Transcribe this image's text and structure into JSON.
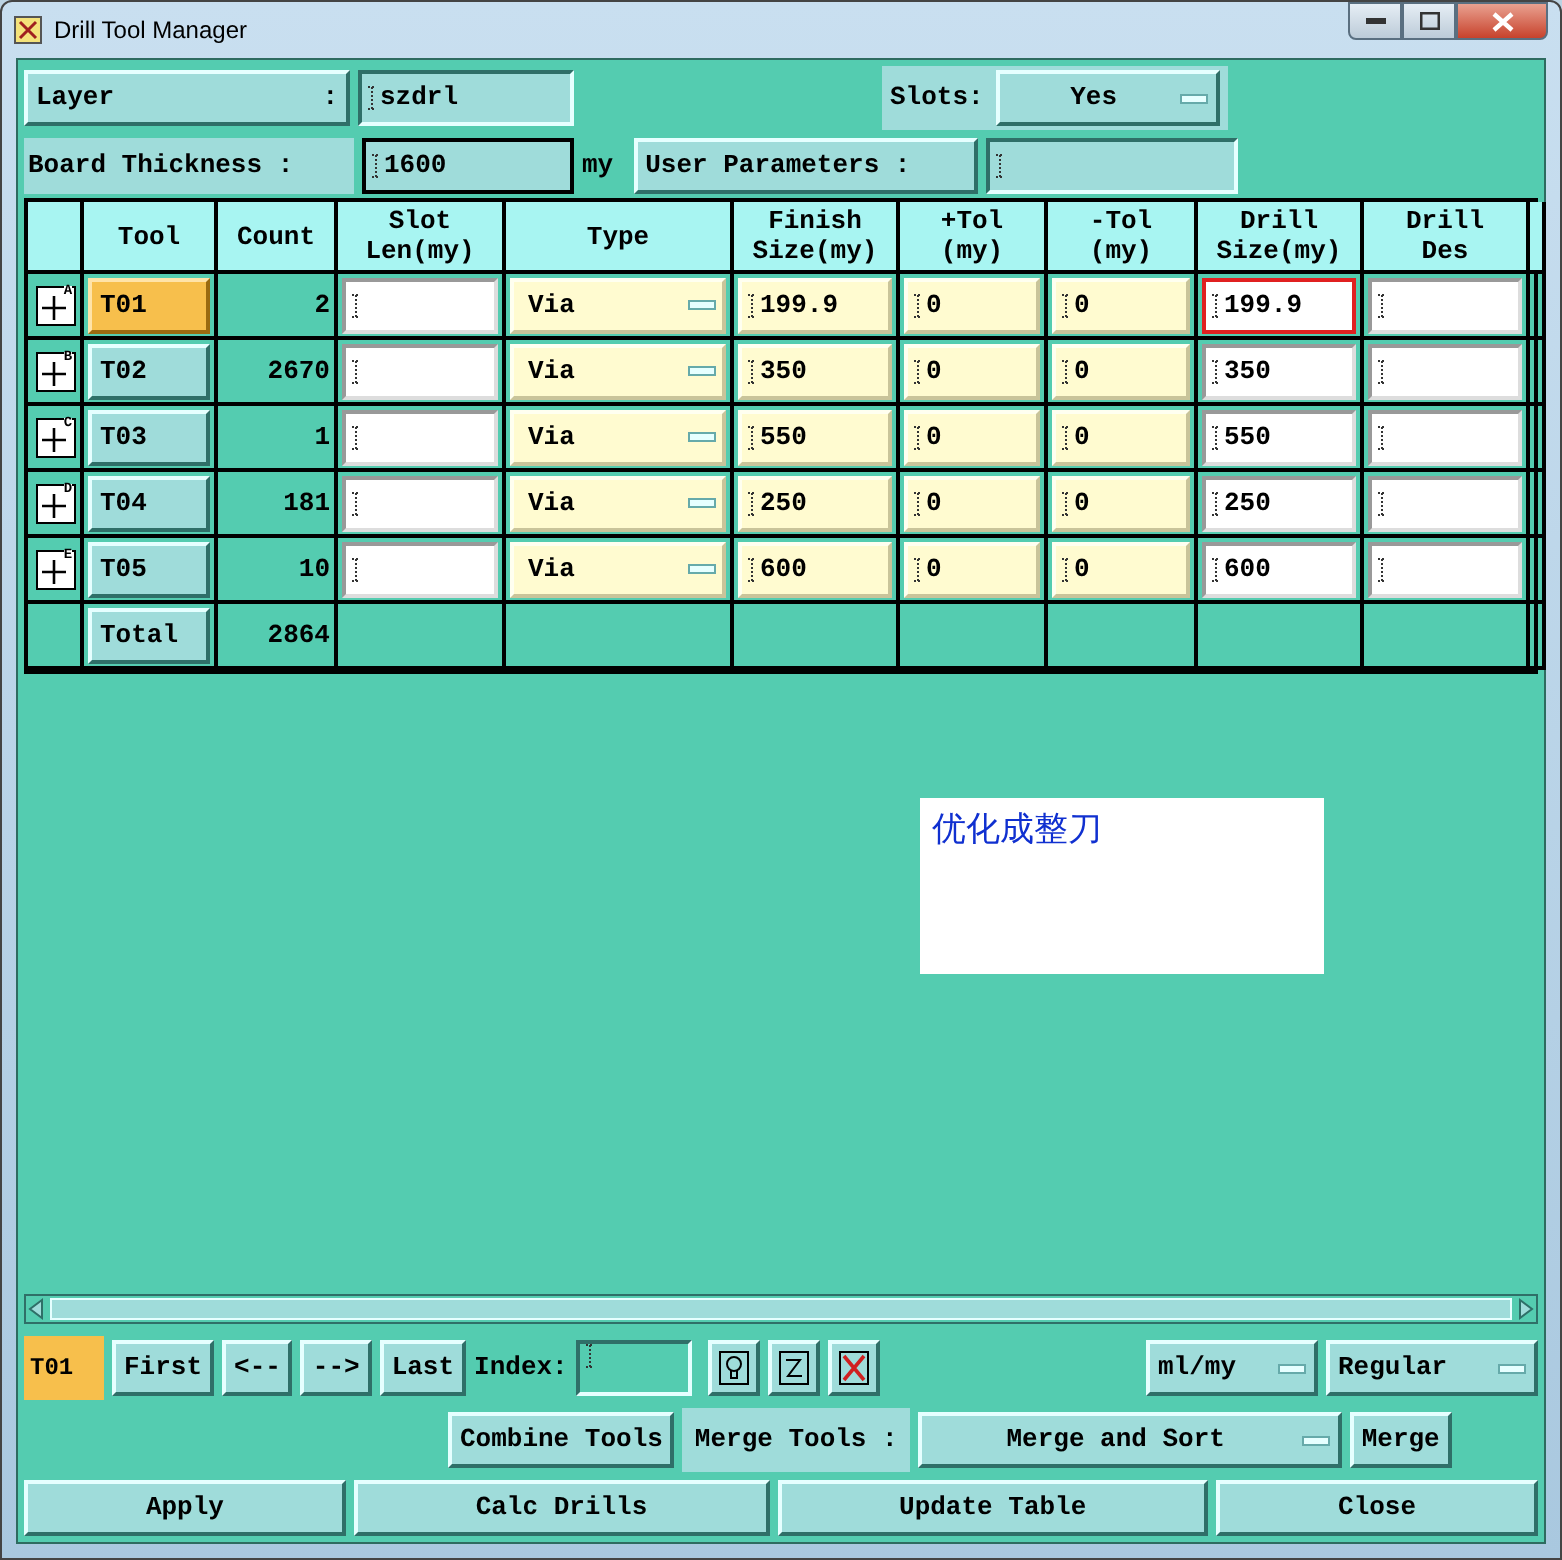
{
  "window": {
    "title": "Drill Tool Manager"
  },
  "layer": {
    "label": "Layer",
    "colon": ":",
    "value": "szdrl"
  },
  "slots": {
    "label": "Slots:",
    "value": "Yes"
  },
  "board_thickness": {
    "label": "Board Thickness :",
    "value": "1600",
    "unit": "my"
  },
  "user_parameters": {
    "label": "User Parameters :"
  },
  "table": {
    "columns": [
      "Tool",
      "Count",
      "Slot\nLen(my)",
      "Type",
      "Finish\nSize(my)",
      "+Tol\n(my)",
      "-Tol\n(my)",
      "Drill\nSize(my)",
      "Drill\nDes"
    ],
    "rows": [
      {
        "marker": "A",
        "tool": "T01",
        "selected": true,
        "count": "2",
        "type": "Via",
        "finish_size": "199.9",
        "plus_tol": "0",
        "minus_tol": "0",
        "drill_size": "199.9",
        "highlighted": true
      },
      {
        "marker": "B",
        "tool": "T02",
        "selected": false,
        "count": "2670",
        "type": "Via",
        "finish_size": "350",
        "plus_tol": "0",
        "minus_tol": "0",
        "drill_size": "350",
        "highlighted": false
      },
      {
        "marker": "C",
        "tool": "T03",
        "selected": false,
        "count": "1",
        "type": "Via",
        "finish_size": "550",
        "plus_tol": "0",
        "minus_tol": "0",
        "drill_size": "550",
        "highlighted": false
      },
      {
        "marker": "D",
        "tool": "T04",
        "selected": false,
        "count": "181",
        "type": "Via",
        "finish_size": "250",
        "plus_tol": "0",
        "minus_tol": "0",
        "drill_size": "250",
        "highlighted": false
      },
      {
        "marker": "E",
        "tool": "T05",
        "selected": false,
        "count": "10",
        "type": "Via",
        "finish_size": "600",
        "plus_tol": "0",
        "minus_tol": "0",
        "drill_size": "600",
        "highlighted": false
      }
    ],
    "total": {
      "label": "Total",
      "count": "2864"
    }
  },
  "note": {
    "text": "优化成整刀"
  },
  "navigation": {
    "current": "T01",
    "buttons": [
      "First",
      "<--",
      "-->",
      "Last"
    ],
    "index_label": "Index:",
    "units": "ml/my",
    "mode": "Regular"
  },
  "merge": {
    "combine": "Combine Tools",
    "label": "Merge Tools :",
    "option": "Merge and Sort",
    "button": "Merge"
  },
  "actions": [
    "Apply",
    "Calc Drills",
    "Update Table",
    "Close"
  ]
}
